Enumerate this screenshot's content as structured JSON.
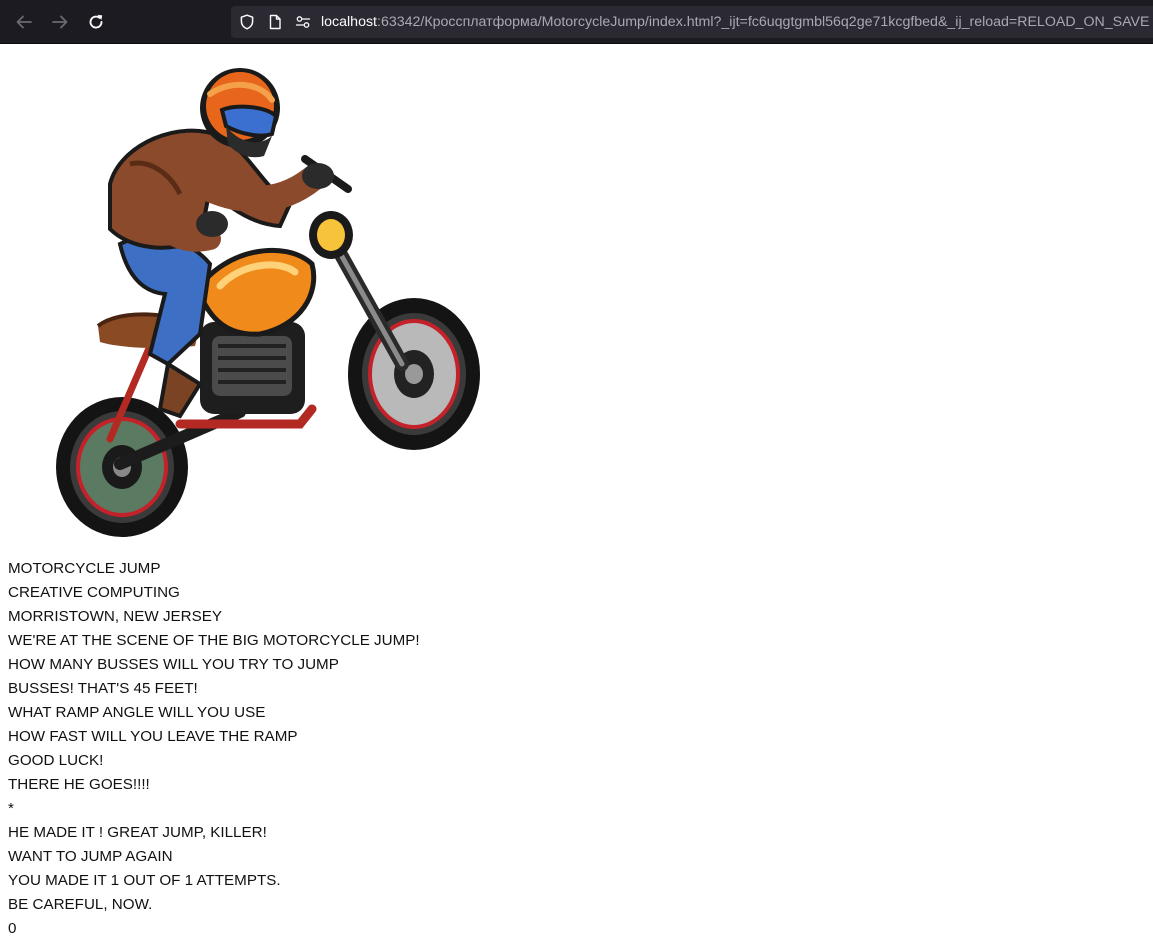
{
  "browser": {
    "url_host": "localhost",
    "url_rest": ":63342/Кроссплатформа/MotorcycleJump/index.html?_ijt=fc6uqgtgmbl56q2ge71kcgfbed&_ij_reload=RELOAD_ON_SAVE",
    "icons": [
      "back-arrow-icon",
      "forward-arrow-icon",
      "reload-icon",
      "shield-icon",
      "page-icon",
      "permissions-icon"
    ],
    "colors": {
      "toolbar": "#1c1b22",
      "urlbar": "#2b2a33",
      "url_text": "#fbfbfe",
      "url_dim": "#a9a9b3"
    }
  },
  "page": {
    "lines": [
      "MOTORCYCLE JUMP",
      "CREATIVE COMPUTING",
      "MORRISTOWN, NEW JERSEY",
      "WE'RE AT THE SCENE OF THE BIG MOTORCYCLE JUMP!",
      "HOW MANY BUSSES WILL YOU TRY TO JUMP",
      "BUSSES! THAT'S 45 FEET!",
      "WHAT RAMP ANGLE WILL YOU USE",
      "HOW FAST WILL YOU LEAVE THE RAMP",
      "GOOD LUCK!",
      "THERE HE GOES!!!!",
      "*",
      "HE MADE IT ! GREAT JUMP, KILLER!",
      "WANT TO JUMP AGAIN",
      "YOU MADE IT 1 OUT OF 1 ATTEMPTS.",
      "BE CAREFUL, NOW.",
      "0"
    ]
  }
}
